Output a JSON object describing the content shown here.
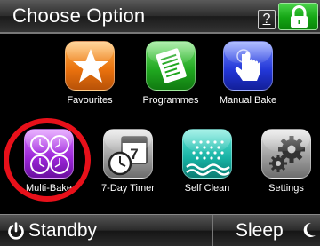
{
  "header": {
    "title": "Choose Option",
    "help_label": "?",
    "lock_icon": "lock-icon"
  },
  "tiles": [
    {
      "label": "Favourites",
      "icon": "star-icon",
      "color": "#e8700d"
    },
    {
      "label": "Programmes",
      "icon": "document-icon",
      "color": "#1fa61f"
    },
    {
      "label": "Manual Bake",
      "icon": "hand-pointer-icon",
      "color": "#2236d6"
    },
    {
      "label": "Multi-Bake",
      "icon": "four-timers-icon",
      "color": "#9a25d6",
      "highlighted": true
    },
    {
      "label": "7-Day Timer",
      "icon": "calendar-clock-icon",
      "color": "#9a9a9a"
    },
    {
      "label": "Self Clean",
      "icon": "water-spray-icon",
      "color": "#16b1a3"
    },
    {
      "label": "Settings",
      "icon": "gears-icon",
      "color": "#9a9a9a"
    }
  ],
  "footer": {
    "standby_label": "Standby",
    "sleep_label": "Sleep"
  },
  "colors": {
    "highlight_ring": "#e8101a",
    "lock_green": "#14a514"
  }
}
